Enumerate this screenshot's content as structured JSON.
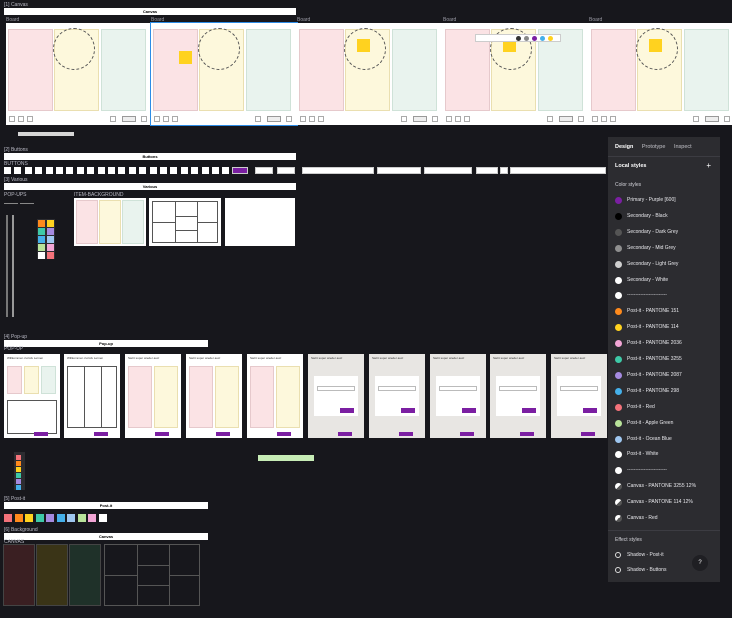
{
  "sections": {
    "canvas": "[1] Canvas",
    "buttons": "[2] Buttons",
    "various": "[3] Various",
    "popup": "[4] Pop-up",
    "postit": "[5] Post-it",
    "background": "[6] Background"
  },
  "bars": {
    "canvas": "Canvas",
    "buttons": "Buttons",
    "various": "Various",
    "popup": "Pop-up",
    "postit": "Post-it",
    "background": "Canvas"
  },
  "sublabels": {
    "buttons": "BUTTONS",
    "popups": "POP-UPS",
    "item_background": "ITEM-BACKGROUND",
    "popup": "POP-UP",
    "canvas": "CANVAS"
  },
  "boards": [
    {
      "label": "Board"
    },
    {
      "label": "Board"
    },
    {
      "label": "Board"
    },
    {
      "label": "Board"
    },
    {
      "label": "Board"
    }
  ],
  "popups": [
    {
      "title": "Willkommen zurück Lernen"
    },
    {
      "title": "Willkommen zurück Lernen"
    },
    {
      "title": "Sieht super wieder aus!"
    },
    {
      "title": "Sieht super wieder aus!"
    },
    {
      "title": "Sieht super wieder aus!"
    },
    {
      "title": "Sieht super wieder aus!"
    },
    {
      "title": "Sieht super wieder aus!"
    },
    {
      "title": "Sieht super wieder aus!"
    },
    {
      "title": "Sieht super wieder aus!"
    },
    {
      "title": "Sieht super wieder aus!"
    }
  ],
  "panel": {
    "tabs": [
      "Design",
      "Prototype",
      "Inspect"
    ],
    "local_styles": "Local styles",
    "add": "+",
    "color_styles_heading": "Color styles",
    "color_styles": [
      {
        "name": "Primary - Purple [600]",
        "color": "#7b1fa2"
      },
      {
        "name": "Secondary - Black",
        "color": "#000000"
      },
      {
        "name": "Secondary - Dark Grey",
        "color": "#555555"
      },
      {
        "name": "Secondary - Mid Grey",
        "color": "#8f8f8f"
      },
      {
        "name": "Secondary - Light Grey",
        "color": "#cfcfcf"
      },
      {
        "name": "Secondary - White",
        "color": "#ffffff"
      },
      {
        "name": "------------------------",
        "color": "#ffffff"
      },
      {
        "name": "Post-it - PANTONE 151",
        "color": "#ff8a1c"
      },
      {
        "name": "Post-it - PANTONE 114",
        "color": "#ffd21f"
      },
      {
        "name": "Post-it - PANTONE 2036",
        "color": "#f3a6d6"
      },
      {
        "name": "Post-it - PANTONE 3255",
        "color": "#3ec9a7"
      },
      {
        "name": "Post-it - PANTONE 2087",
        "color": "#a58ae0"
      },
      {
        "name": "Post-it - PANTONE 298",
        "color": "#45b0ea"
      },
      {
        "name": "Post-it - Red",
        "color": "#f4727a"
      },
      {
        "name": "Post-it - Apple Green",
        "color": "#b9e39a"
      },
      {
        "name": "Post-it - Ocean Blue",
        "color": "#9fc7f0"
      },
      {
        "name": "Post-it - White",
        "color": "#ffffff"
      },
      {
        "name": "------------------------",
        "color": "#ffffff"
      },
      {
        "name": "Canvas - PANTONE 3255 12%",
        "color": "#e9f3ee"
      },
      {
        "name": "Canvas - PANTONE 114 12%",
        "color": "#fdf8dc"
      },
      {
        "name": "Canvas - Red",
        "color": "#fbe3e5"
      }
    ],
    "effect_styles_heading": "Effect styles",
    "effect_styles": [
      {
        "name": "Shadow - Post-it"
      },
      {
        "name": "Shadow - Buttons"
      }
    ]
  },
  "help": "?",
  "postit_colors": [
    "#f4727a",
    "#ff8a1c",
    "#ffd21f",
    "#3ec9a7",
    "#a58ae0",
    "#45b0ea",
    "#9fc7f0",
    "#b9e39a",
    "#f3a6d6",
    "#ffffff"
  ],
  "canvas_colors": [
    "#3a1f22",
    "#3a3417",
    "#1f3129"
  ]
}
